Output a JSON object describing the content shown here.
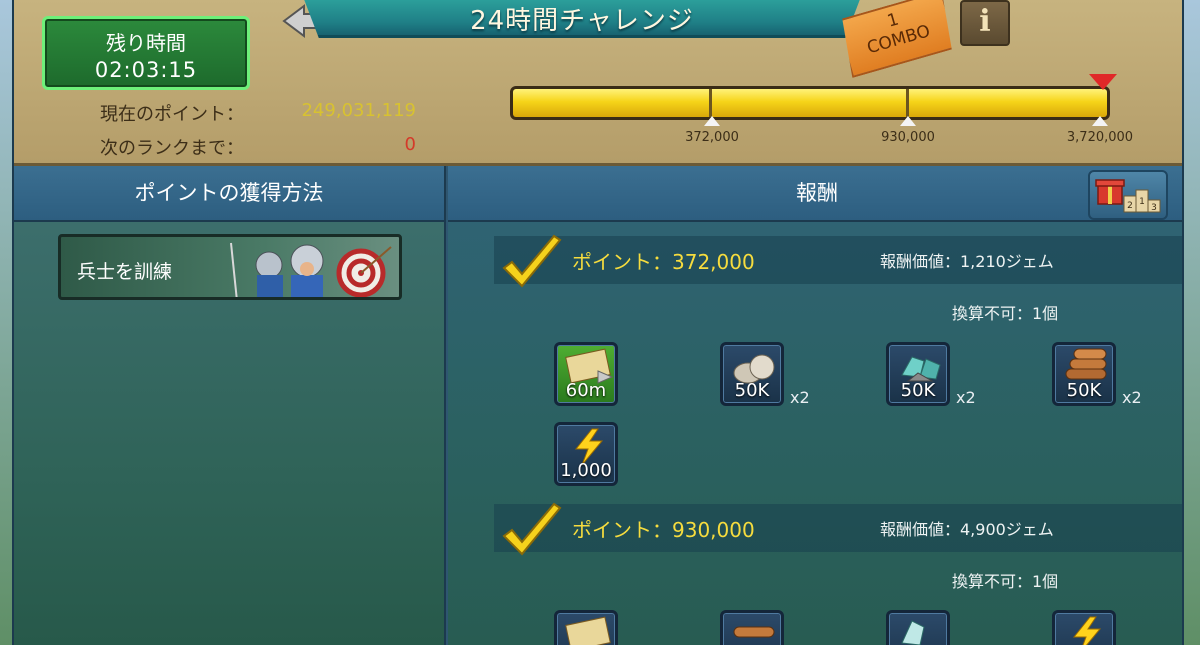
{
  "header": {
    "title": "24時間チャレンジ",
    "combo": {
      "count": "1",
      "label": "COMBO"
    },
    "info_icon": "i"
  },
  "timer": {
    "label": "残り時間",
    "value": "02:03:15"
  },
  "stats": {
    "current_points_label": "現在のポイント：",
    "current_points_value": "249,031,119",
    "next_rank_label": "次のランクまで：",
    "next_rank_value": "0"
  },
  "progress": {
    "fill_fraction": 1.0,
    "milestones": [
      "372,000",
      "930,000",
      "3,720,000"
    ]
  },
  "columns": {
    "left_title": "ポイントの獲得方法",
    "right_title": "報酬"
  },
  "methods": [
    {
      "label": "兵士を訓練"
    }
  ],
  "rewards": [
    {
      "points": "ポイント：372,000",
      "value": "報酬価値：1,210ジェム",
      "no_convert": "換算不可：1個",
      "items": [
        {
          "icon": "speedup-scroll-icon",
          "amount": "60m",
          "mult": ""
        },
        {
          "icon": "stone-icon",
          "amount": "50K",
          "mult": "x2"
        },
        {
          "icon": "ore-icon",
          "amount": "50K",
          "mult": "x2"
        },
        {
          "icon": "timber-icon",
          "amount": "50K",
          "mult": "x2"
        },
        {
          "icon": "energy-icon",
          "amount": "1,000",
          "mult": ""
        }
      ]
    },
    {
      "points": "ポイント：930,000",
      "value": "報酬価値：4,900ジェム",
      "no_convert": "換算不可：1個",
      "items": [
        {
          "icon": "speedup-scroll-icon",
          "amount": "",
          "mult": ""
        },
        {
          "icon": "timber-icon",
          "amount": "",
          "mult": ""
        },
        {
          "icon": "ore-icon",
          "amount": "",
          "mult": ""
        },
        {
          "icon": "energy-icon",
          "amount": "",
          "mult": ""
        }
      ]
    }
  ],
  "colors": {
    "points_yellow": "#f6dc3e",
    "next_rank_red": "#d43a2a",
    "timer_green": "#2c8a3c",
    "bar_yellow": "#f6d419"
  }
}
